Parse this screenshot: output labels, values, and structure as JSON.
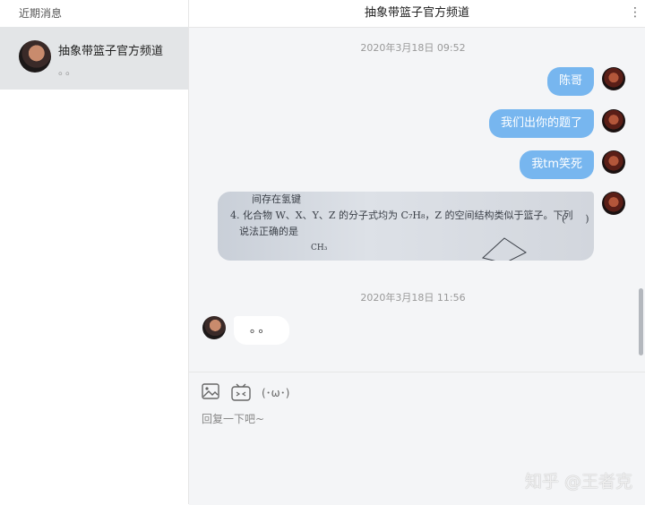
{
  "sidebar": {
    "header": "近期消息",
    "conversation": {
      "title": "抽象带篮子官方频道",
      "preview": "。。"
    }
  },
  "chat": {
    "title": "抽象带篮子官方频道",
    "menu_icon": "more-vertical-icon",
    "timestamp_1": "2020年3月18日 09:52",
    "outgoing": [
      "陈哥",
      "我们出你的题了",
      "我tm笑死"
    ],
    "image_text": {
      "line1": "间存在氢键",
      "line2": "4. 化合物 W、X、Y、Z 的分子式均为 C₇H₈，Z 的空间结构类似于篮子。下列",
      "line3": "说法正确的是",
      "line3_right": "(　　)",
      "line4": "CH₃"
    },
    "timestamp_2": "2020年3月18日 11:56",
    "incoming": "。。"
  },
  "composer": {
    "image_icon": "image-icon",
    "emoji_icon": "tv-emoji-icon",
    "kaomoji": "(･ω･)",
    "placeholder": "回复一下吧~"
  },
  "watermark": "知乎 @王者克"
}
